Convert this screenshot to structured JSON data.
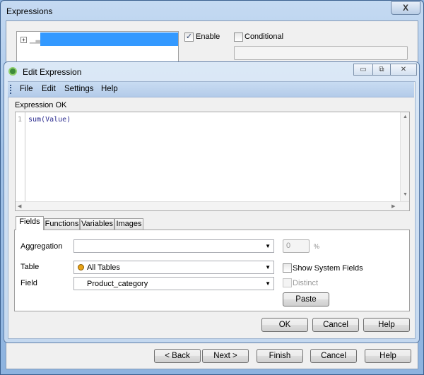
{
  "outer_window": {
    "title": "Expressions",
    "close_label": "X",
    "enable": {
      "label": "Enable",
      "checked": true
    },
    "conditional": {
      "label": "Conditional",
      "checked": false
    },
    "conditional_value": "",
    "buttons": {
      "back": "< Back",
      "next": "Next >",
      "finish": "Finish",
      "cancel": "Cancel",
      "help": "Help"
    }
  },
  "dialog": {
    "title": "Edit Expression",
    "window_buttons": {
      "minimize": "▭",
      "restore": "⧉",
      "close": "✕"
    },
    "menu": [
      "File",
      "Edit",
      "Settings",
      "Help"
    ],
    "status": "Expression OK",
    "editor": {
      "line_number": "1",
      "code": "sum(Value)"
    },
    "tabs": [
      "Fields",
      "Functions",
      "Variables",
      "Images"
    ],
    "active_tab": "Fields",
    "fields": {
      "aggregation_label": "Aggregation",
      "aggregation_value": "",
      "percent_value": "0",
      "percent_symbol": "%",
      "table_label": "Table",
      "table_value": "All Tables",
      "field_label": "Field",
      "field_value": "Product_category",
      "show_system_fields": {
        "label": "Show System Fields",
        "checked": false
      },
      "distinct": {
        "label": "Distinct",
        "checked": false,
        "disabled": true
      },
      "paste_label": "Paste"
    },
    "buttons": {
      "ok": "OK",
      "cancel": "Cancel",
      "help": "Help"
    }
  },
  "colors": {
    "selection": "#3399ff",
    "menu_bar": "#b9d1ea",
    "table_dot": "#e8a317"
  }
}
